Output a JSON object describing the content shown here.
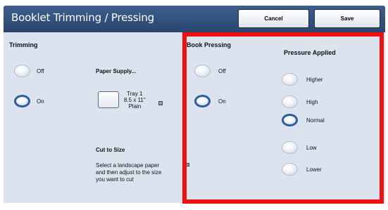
{
  "header": {
    "title": "Booklet Trimming / Pressing",
    "cancel_label": "Cancel",
    "save_label": "Save"
  },
  "trimming": {
    "label": "Trimming",
    "options": [
      "Off",
      "On"
    ],
    "selected": "On"
  },
  "paper_supply": {
    "label": "Paper Supply...",
    "tray": "Tray 1",
    "size": "8.5 x 11\"",
    "type": "Plain"
  },
  "cut_to_size": {
    "label": "Cut to Size",
    "description": [
      "Select a landscape paper",
      "and then adjust to the size",
      "you want to cut"
    ]
  },
  "book_pressing": {
    "label": "Book Pressing",
    "options": [
      "Off",
      "On"
    ],
    "selected": "On"
  },
  "pressure": {
    "label": "Pressure Applied",
    "options": [
      "Higher",
      "High",
      "Normal",
      "Low",
      "Lower"
    ],
    "selected": "Normal"
  },
  "colors": {
    "header": "#2f4d78",
    "panel": "#dbe3ee",
    "highlight": "#ee1111",
    "selected_ring": "#2f5f99"
  }
}
